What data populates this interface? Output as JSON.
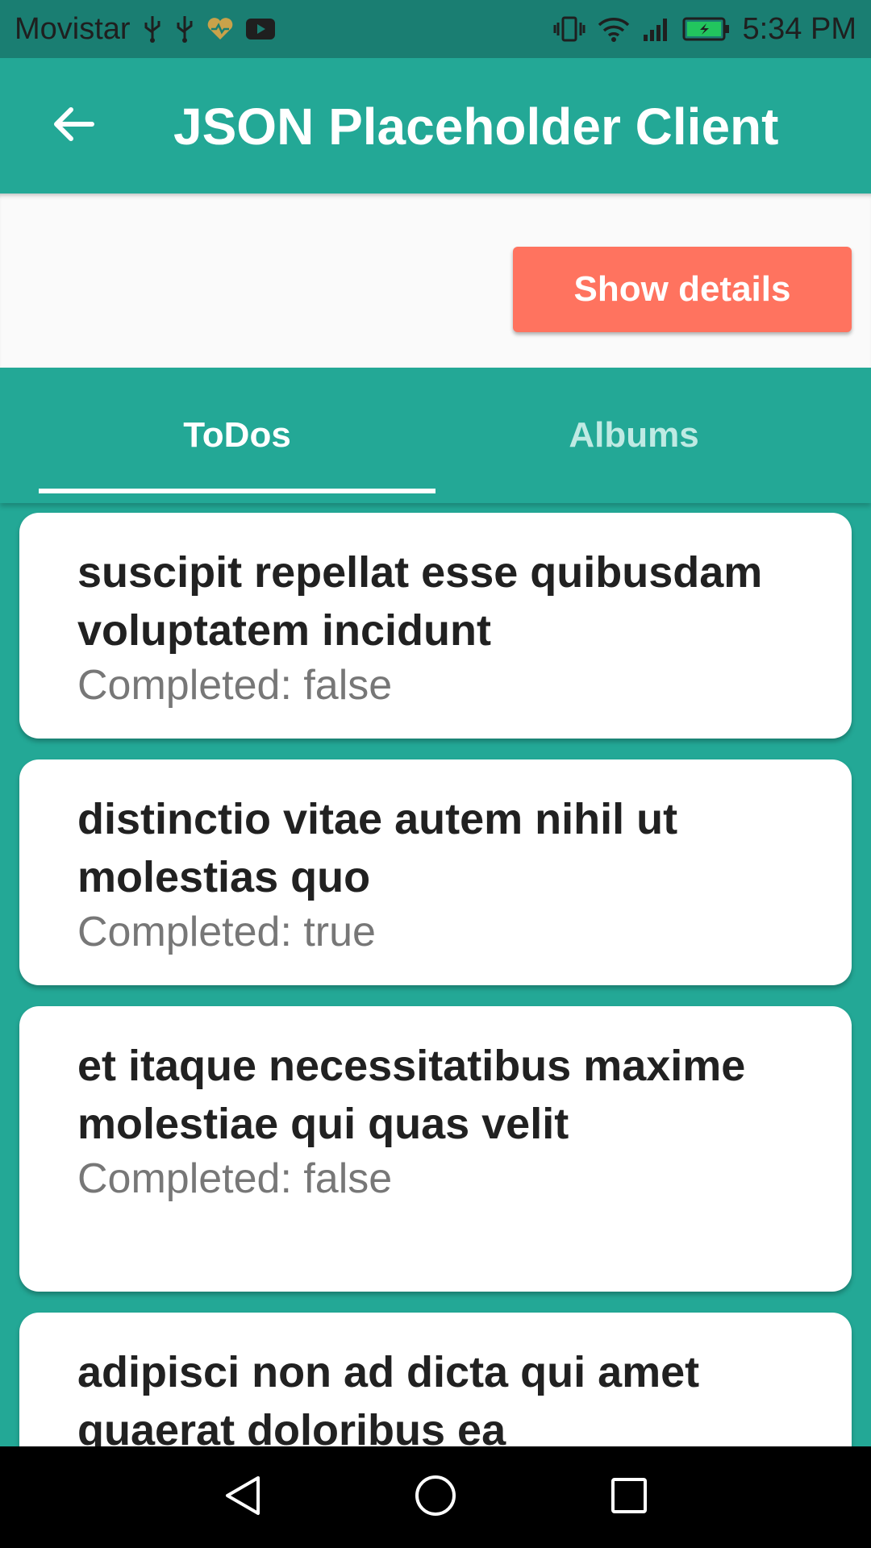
{
  "status": {
    "carrier": "Movistar",
    "time": "5:34 PM"
  },
  "appbar": {
    "title": "JSON Placeholder Client"
  },
  "panel": {
    "button_label": "Show details"
  },
  "tabs": [
    {
      "label": "ToDos",
      "selected": true
    },
    {
      "label": "Albums",
      "selected": false
    }
  ],
  "todos": [
    {
      "title": "suscipit repellat esse quibusdam voluptatem incidunt",
      "completed": "Completed: false"
    },
    {
      "title": "distinctio vitae autem nihil ut molestias quo",
      "completed": "Completed: true"
    },
    {
      "title": "et itaque necessitatibus maxime molestiae qui quas velit",
      "completed": "Completed: false"
    },
    {
      "title": "adipisci non ad dicta qui amet quaerat doloribus ea",
      "completed": ""
    }
  ],
  "colors": {
    "primary": "#23a896",
    "status_bar": "#1a7e72",
    "accent": "#ff735f",
    "panel_bg": "#fafafa"
  },
  "icons": [
    "usb-icon",
    "heart-icon",
    "youtube-icon",
    "vibrate-icon",
    "wifi-icon",
    "signal-icon",
    "battery-icon",
    "back-arrow-icon",
    "nav-back-icon",
    "nav-home-icon",
    "nav-recents-icon"
  ]
}
